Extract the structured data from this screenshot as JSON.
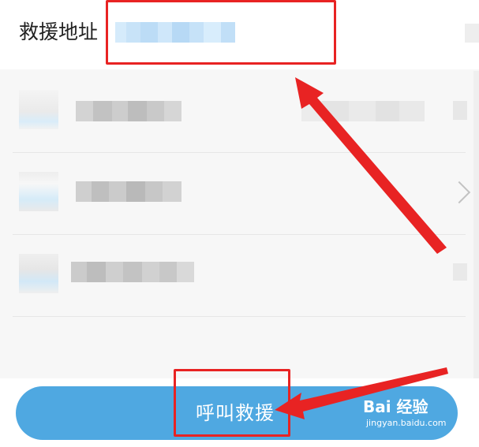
{
  "header": {
    "label": "救援地址"
  },
  "action": {
    "call_label": "呼叫救援"
  },
  "watermark": {
    "brand": "Bai 经验",
    "url": "jingyan.baidu.com"
  },
  "colors": {
    "primary_button": "#4fa8e1",
    "annotation_red": "#e82323"
  },
  "icons": {
    "row_chevron": "chevron-right-icon"
  }
}
